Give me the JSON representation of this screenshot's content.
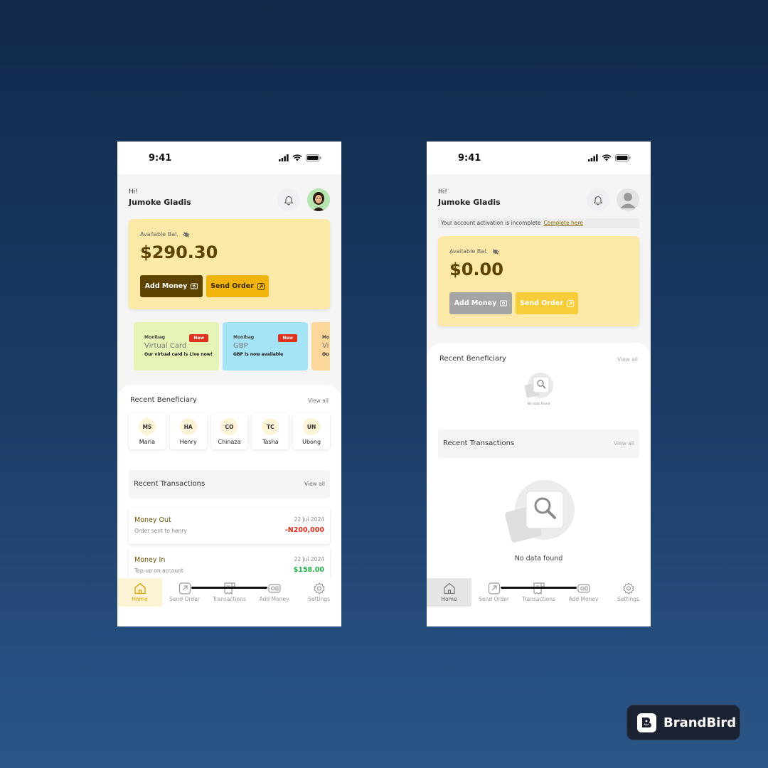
{
  "status_bar": {
    "time": "9:41"
  },
  "left_screen": {
    "greeting": "Hi!",
    "user_name": "Jumoke Gladis",
    "balance": {
      "label": "Available Bal.",
      "amount": "$290.30"
    },
    "buttons": {
      "add_money": "Add Money",
      "send_order": "Send Order"
    },
    "promos": [
      {
        "brand": "Monibag",
        "title": "Virtual Card",
        "subtitle": "Our virtual card is Live now!",
        "badge": "New",
        "color": "#e6f5b5"
      },
      {
        "brand": "Monibag",
        "title": "GBP",
        "subtitle": "GBP is now available",
        "badge": "New",
        "color": "#a5e3f7"
      },
      {
        "brand": "Mo",
        "title": "Vi",
        "subtitle": "Ou",
        "badge": "",
        "color": "#fcd79c"
      }
    ],
    "recent_beneficiary": {
      "title": "Recent Beneficiary",
      "view_all": "View all",
      "items": [
        {
          "initials": "MS",
          "name": "Maria"
        },
        {
          "initials": "HA",
          "name": "Henry"
        },
        {
          "initials": "CO",
          "name": "Chinaza"
        },
        {
          "initials": "TC",
          "name": "Tasha"
        },
        {
          "initials": "UN",
          "name": "Ubong"
        }
      ]
    },
    "recent_transactions": {
      "title": "Recent Transactions",
      "view_all": "View all",
      "items": [
        {
          "title": "Money Out",
          "desc": "Order sent to henry",
          "date": "22 Jul 2024",
          "amount": "-N200,000",
          "amount_color": "#e02d1b"
        },
        {
          "title": "Money In",
          "desc": "Top-up on account",
          "date": "22 Jul 2024",
          "amount": "$158.00",
          "amount_color": "#22b24c"
        }
      ]
    }
  },
  "right_screen": {
    "greeting": "Hi!",
    "user_name": "Jumoke Gladis",
    "activation": {
      "text": "Your account activation is incomplete",
      "link": "Complete here"
    },
    "balance": {
      "label": "Available Bal.",
      "amount": "$0.00"
    },
    "buttons": {
      "add_money": "Add Money",
      "send_order": "Send Order"
    },
    "recent_beneficiary": {
      "title": "Recent Beneficiary",
      "view_all": "View all",
      "empty_text": "No data found"
    },
    "recent_transactions": {
      "title": "Recent Transactions",
      "view_all": "View all",
      "empty_text": "No data found"
    }
  },
  "nav": {
    "items": [
      {
        "label": "Home",
        "icon": "home-icon"
      },
      {
        "label": "Send Order",
        "icon": "send-order-icon"
      },
      {
        "label": "Transactions",
        "icon": "transactions-icon"
      },
      {
        "label": "Add Money",
        "icon": "add-money-icon"
      },
      {
        "label": "Settings",
        "icon": "settings-icon"
      }
    ],
    "active": "Home"
  },
  "brand": {
    "name": "BrandBird"
  },
  "colors": {
    "accent": "#f0b40c",
    "card": "#fce9a8",
    "dark_button": "#5c4300",
    "background": "#1c3d68"
  }
}
